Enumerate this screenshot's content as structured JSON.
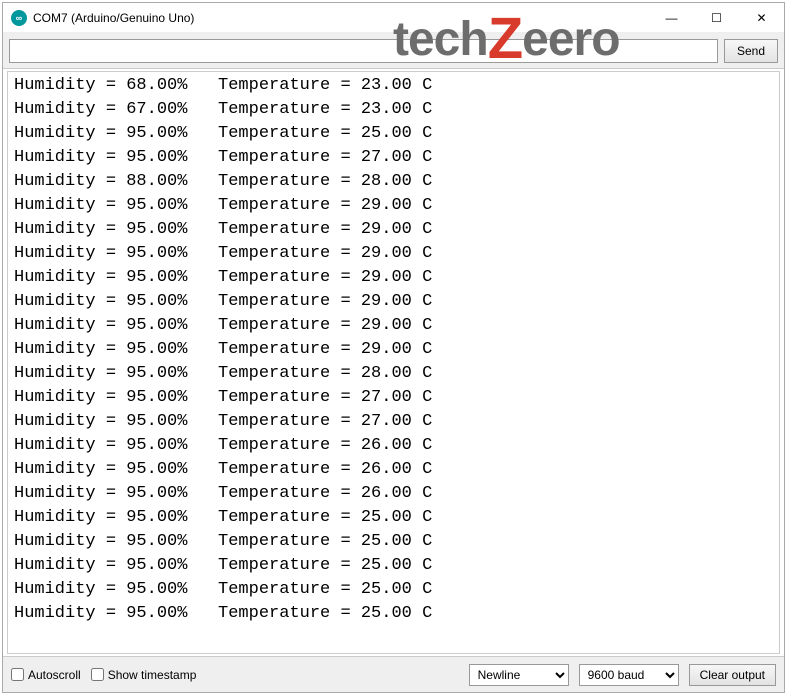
{
  "window": {
    "title": "COM7 (Arduino/Genuino Uno)"
  },
  "toolbar": {
    "input_value": "",
    "send_label": "Send"
  },
  "watermark": {
    "prefix": "tech",
    "accent": "Z",
    "suffix": "eero"
  },
  "readings": [
    {
      "humidity": "68.00",
      "temperature": "23.00"
    },
    {
      "humidity": "67.00",
      "temperature": "23.00"
    },
    {
      "humidity": "95.00",
      "temperature": "25.00"
    },
    {
      "humidity": "95.00",
      "temperature": "27.00"
    },
    {
      "humidity": "88.00",
      "temperature": "28.00"
    },
    {
      "humidity": "95.00",
      "temperature": "29.00"
    },
    {
      "humidity": "95.00",
      "temperature": "29.00"
    },
    {
      "humidity": "95.00",
      "temperature": "29.00"
    },
    {
      "humidity": "95.00",
      "temperature": "29.00"
    },
    {
      "humidity": "95.00",
      "temperature": "29.00"
    },
    {
      "humidity": "95.00",
      "temperature": "29.00"
    },
    {
      "humidity": "95.00",
      "temperature": "29.00"
    },
    {
      "humidity": "95.00",
      "temperature": "28.00"
    },
    {
      "humidity": "95.00",
      "temperature": "27.00"
    },
    {
      "humidity": "95.00",
      "temperature": "27.00"
    },
    {
      "humidity": "95.00",
      "temperature": "26.00"
    },
    {
      "humidity": "95.00",
      "temperature": "26.00"
    },
    {
      "humidity": "95.00",
      "temperature": "26.00"
    },
    {
      "humidity": "95.00",
      "temperature": "25.00"
    },
    {
      "humidity": "95.00",
      "temperature": "25.00"
    },
    {
      "humidity": "95.00",
      "temperature": "25.00"
    },
    {
      "humidity": "95.00",
      "temperature": "25.00"
    },
    {
      "humidity": "95.00",
      "temperature": "25.00"
    }
  ],
  "line_template": {
    "humidity_label": "Humidity = ",
    "humidity_unit": "%",
    "temperature_label": "Temperature = ",
    "temperature_unit": " C"
  },
  "bottom": {
    "autoscroll_label": "Autoscroll",
    "autoscroll_checked": false,
    "timestamp_label": "Show timestamp",
    "timestamp_checked": false,
    "line_ending_selected": "Newline",
    "baud_selected": "9600 baud",
    "clear_label": "Clear output"
  }
}
